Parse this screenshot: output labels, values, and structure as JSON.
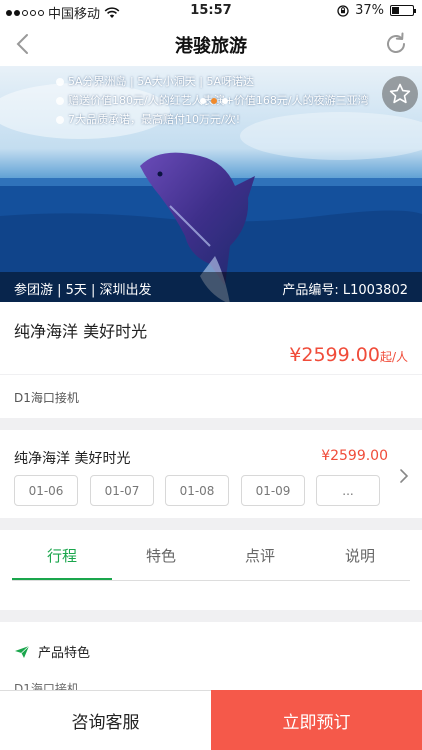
{
  "status_bar": {
    "carrier": "中国移动",
    "time": "15:57",
    "battery": "37%",
    "battery_level": 0.37
  },
  "nav": {
    "title": "港骏旅游"
  },
  "hero": {
    "selling_points": [
      "5A分界洲岛 | 5A大小洞天 | 5A呀诺达",
      "赠送价值180元/人的红艺人表演+价值168元/人的夜游三亚湾",
      "7大品质承诺，最高赔付10万元/次!"
    ],
    "caption_left": "参团游 | 5天 | 深圳出发",
    "caption_right": "产品编号: L1003802",
    "active_slide": 1,
    "slide_count": 3
  },
  "product": {
    "name": "纯净海洋 美好时光",
    "price": "¥2599.00",
    "price_unit": "起/人"
  },
  "description": "D1海口接机",
  "dates": {
    "title": "纯净海洋 美好时光",
    "price": "¥2599.00",
    "options": [
      "01-06",
      "01-07",
      "01-08",
      "01-09",
      "..."
    ]
  },
  "tabs": [
    {
      "label": "行程"
    },
    {
      "label": "特色"
    },
    {
      "label": "点评"
    },
    {
      "label": "说明"
    }
  ],
  "features": {
    "heading": "产品特色",
    "preview": "D1海口接机"
  },
  "actions": {
    "consult": "咨询客服",
    "book": "立即预订"
  },
  "colors": {
    "accent_green": "#1aa64c",
    "price_red": "#f04c3a",
    "book_button": "#f5594a"
  }
}
